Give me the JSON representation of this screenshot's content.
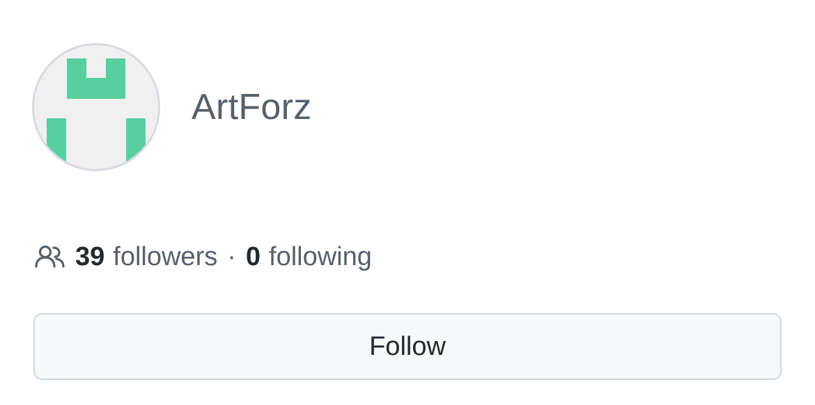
{
  "profile": {
    "username": "ArtForz",
    "avatar_icon": "identicon",
    "avatar_color": "#57cfa0"
  },
  "stats": {
    "icon": "people-icon",
    "followers_count": "39",
    "followers_label": "followers",
    "separator": "·",
    "following_count": "0",
    "following_label": "following"
  },
  "actions": {
    "follow_label": "Follow"
  }
}
